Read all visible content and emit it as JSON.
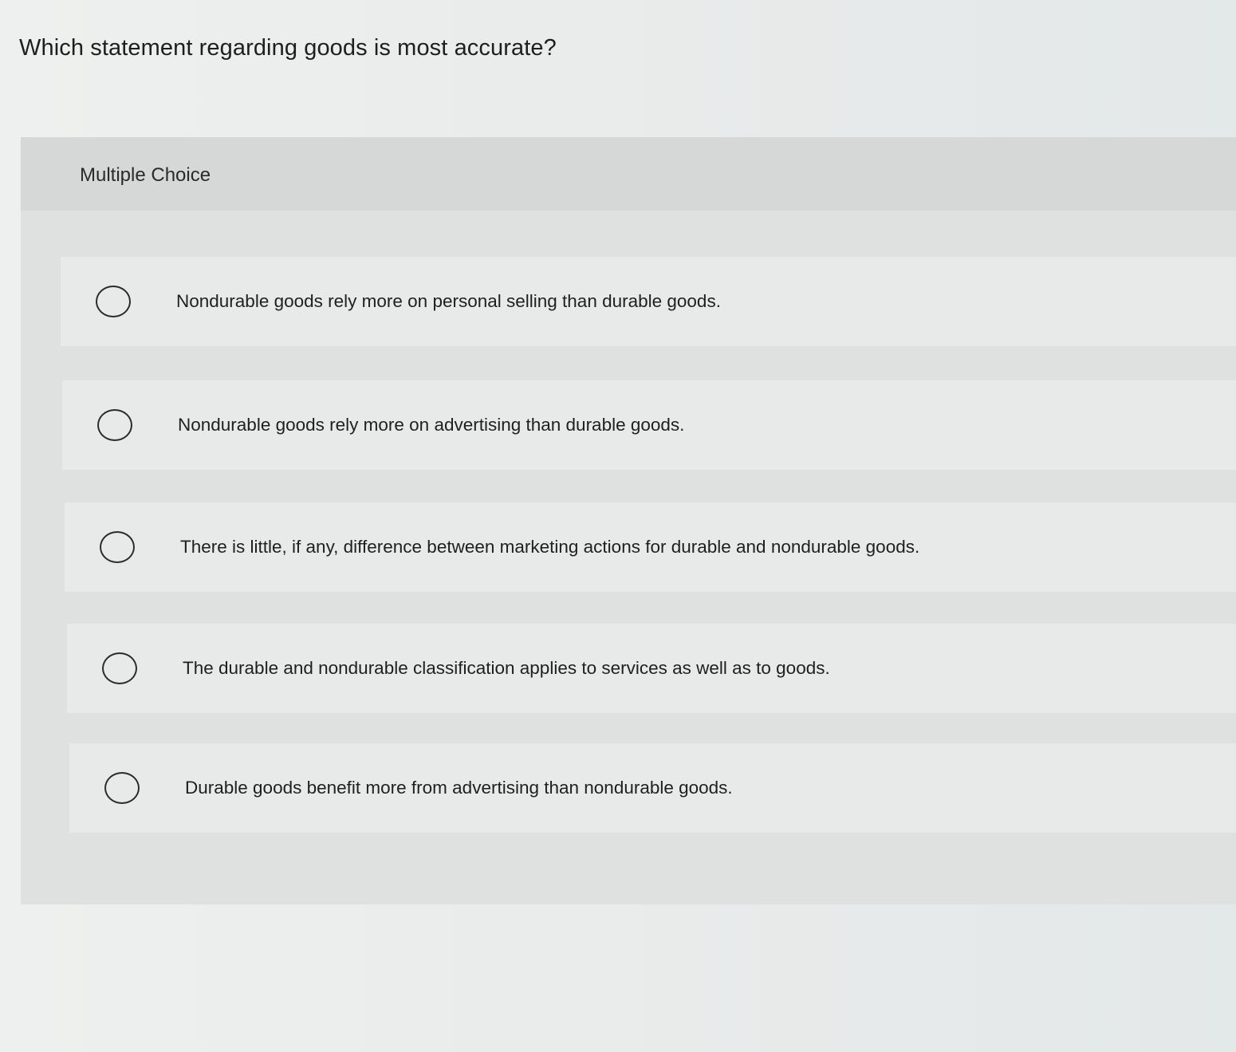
{
  "question": {
    "text": "Which statement regarding goods is most accurate?"
  },
  "panel": {
    "label": "Multiple Choice"
  },
  "options": [
    {
      "label": "Nondurable goods rely more on personal selling than durable goods.",
      "selected": false
    },
    {
      "label": "Nondurable goods rely more on advertising than durable goods.",
      "selected": false
    },
    {
      "label": "There is little, if any, difference between marketing actions for durable and nondurable goods.",
      "selected": false
    },
    {
      "label": "The durable and nondurable classification applies to services as well as to goods.",
      "selected": false
    },
    {
      "label": "Durable goods benefit more from advertising than nondurable goods.",
      "selected": false
    }
  ]
}
